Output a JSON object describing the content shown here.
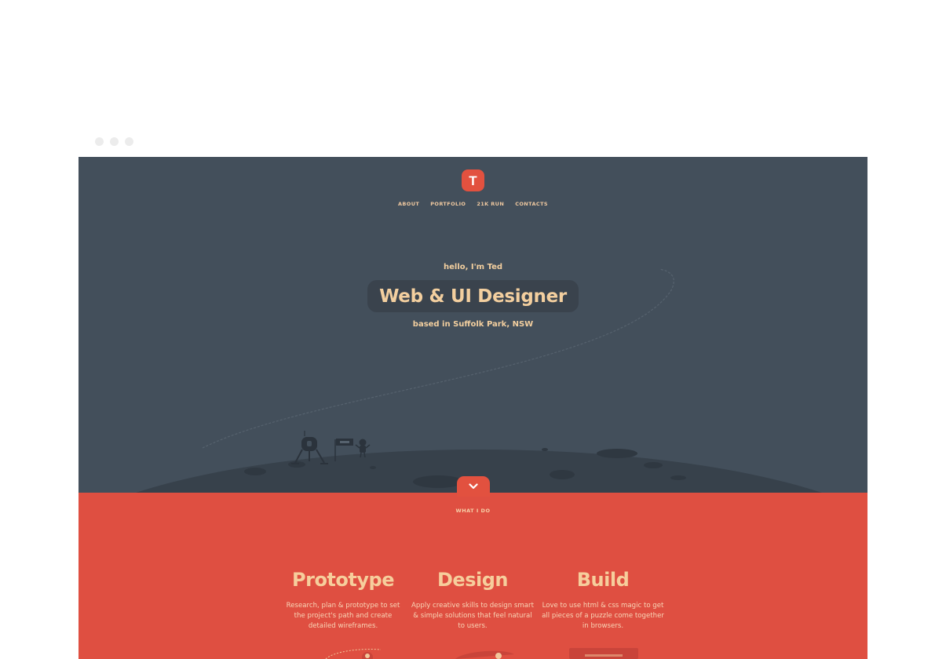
{
  "nav": {
    "items": [
      "ABOUT",
      "PORTFOLIO",
      "21K RUN",
      "CONTACTS"
    ]
  },
  "logo": {
    "letter": "T"
  },
  "hero": {
    "greeting": "hello, I'm Ted",
    "title": "Web & UI Designer",
    "location": "based in Suffolk Park, NSW",
    "scroll_icon": "chevron-down-icon"
  },
  "services": {
    "label": "WHAT I DO",
    "columns": [
      {
        "title": "Prototype",
        "text": "Research, plan & prototype to set the project's path and create detailed wireframes."
      },
      {
        "title": "Design",
        "text": "Apply creative skills to design smart & simple solutions that feel natural to users."
      },
      {
        "title": "Build",
        "text": "Love to use html & css magic to get all pieces of a puzzle come together in browsers."
      }
    ]
  },
  "colors": {
    "hero_bg": "#434f5b",
    "accent": "#e2513f",
    "services_bg": "#df4f41",
    "text_warm": "#f3cf9f"
  }
}
